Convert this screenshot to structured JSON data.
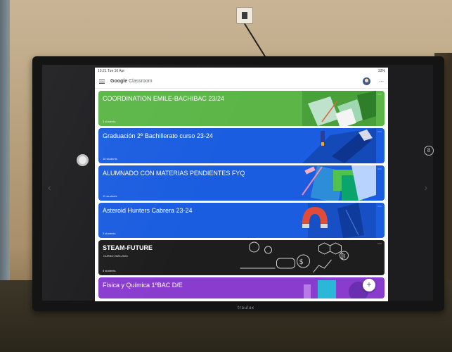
{
  "device": {
    "brand": "traulux"
  },
  "status_bar": {
    "time": "10:21  Tue 16 Apr",
    "battery": "33%"
  },
  "app_bar": {
    "logo_google": "Google",
    "logo_product": "Classroom",
    "more": "⋯"
  },
  "classes": [
    {
      "title": "COORDINATION EMILE-BACHIBAC 23/24",
      "subtitle": "",
      "count": "3 students",
      "color": "#5bb647"
    },
    {
      "title": "Graduación 2º Bachillerato curso 23-24",
      "subtitle": "",
      "count": "16 students",
      "color": "#1a5de0"
    },
    {
      "title": "ALUMNADO CON MATERIAS PENDIENTES FYQ",
      "subtitle": "",
      "count": "11 students",
      "color": "#1a5de0"
    },
    {
      "title": "Asteroid Hunters Cabrera 23-24",
      "subtitle": "",
      "count": "3 students",
      "color": "#1a5de0"
    },
    {
      "title": "STEAM-FUTURE",
      "subtitle": "CURSO 2023-2024",
      "count": "8 students",
      "color": "#1d1d1d"
    },
    {
      "title": "Física y Química 1ºBAC D/E",
      "subtitle": "",
      "count": "",
      "color": "#8a3ccf"
    }
  ],
  "fab": {
    "label": "+"
  },
  "right_avatar": {
    "label": "8"
  }
}
